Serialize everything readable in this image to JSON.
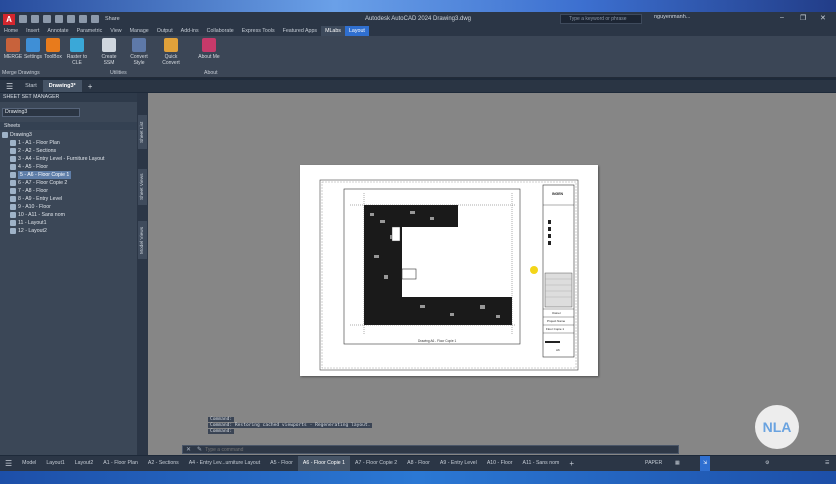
{
  "app": {
    "logo": "A",
    "title": "Autodesk AutoCAD 2024   Drawing3.dwg",
    "share_label": "Share",
    "search_placeholder": "Type a keyword or phrase",
    "user": "nguyenmanh..."
  },
  "ribbon_tabs": [
    "Home",
    "Insert",
    "Annotate",
    "Parametric",
    "View",
    "Manage",
    "Output",
    "Add-ins",
    "Collaborate",
    "Express Tools",
    "Featured Apps",
    "MLabs",
    "Layout"
  ],
  "ribbon_active_tab": "MLabs",
  "ribbon_buttons": [
    {
      "label": "MERGE",
      "color": "#c8623b"
    },
    {
      "label": "Settings",
      "color": "#3f8fd6"
    },
    {
      "label": "ToolBox",
      "color": "#e87b1c"
    },
    {
      "label": "Raster to CLE",
      "color": "#3aa8d8"
    },
    {
      "label": "Create SSM",
      "color": "#cfd6de"
    },
    {
      "label": "Convert Style",
      "color": "#5e79a8"
    },
    {
      "label": "Quick Convert",
      "color": "#e0a13a"
    },
    {
      "label": "About Me",
      "color": "#c63a6a"
    }
  ],
  "ribbon_groups": [
    "Merge Drawings",
    "Utilities",
    "About"
  ],
  "file_tabs": [
    "Start",
    "Drawing3*"
  ],
  "palette": {
    "title": "SHEET SET MANAGER",
    "combo": "Drawing3",
    "sheets_header": "Sheets",
    "root": "Drawing3",
    "items": [
      "1 - A1 - Floor Plan",
      "2 - A2 - Sections",
      "3 - A4 - Entry Level - Furniture Layout",
      "4 - A5 - Floor",
      "5 - A6 - Floor Copie 1",
      "6 - A7 - Floor Copie 2",
      "7 - A8 - Floor",
      "8 - A9 - Entry Level",
      "9 - A10 - Floor",
      "10 - A11 - Sans nom",
      "11 - Layout1",
      "12 - Layout2"
    ],
    "selected_index": 4,
    "side_tabs": [
      "Sheet List",
      "Sheet Views",
      "Model Views"
    ]
  },
  "titleblock": {
    "logo": "INGEN",
    "row1": "Owner",
    "row2": "Project Name",
    "row3": "Floor Copie 1",
    "sheet": "A6"
  },
  "plan_caption": "Drawing A6 - Floor Copie 1",
  "command": {
    "history": [
      "Command:",
      "Command: Restoring cached viewports - Regenerating layout.",
      "Command:"
    ],
    "placeholder": "Type a command"
  },
  "layout_tabs": [
    "Model",
    "Layout1",
    "Layout2",
    "A1 - Floor Plan",
    "A2 - Sections",
    "A4 - Entry Lev...urniture Layout",
    "A5 - Floor",
    "A6 - Floor Copie 1",
    "A7 - Floor Copie 2",
    "A8 - Floor",
    "A9 - Entry Level",
    "A10 - Floor",
    "A11 - Sans nom"
  ],
  "active_layout": "A6 - Floor Copie 1",
  "status": {
    "mode": "PAPER"
  },
  "watermark": "NLA"
}
